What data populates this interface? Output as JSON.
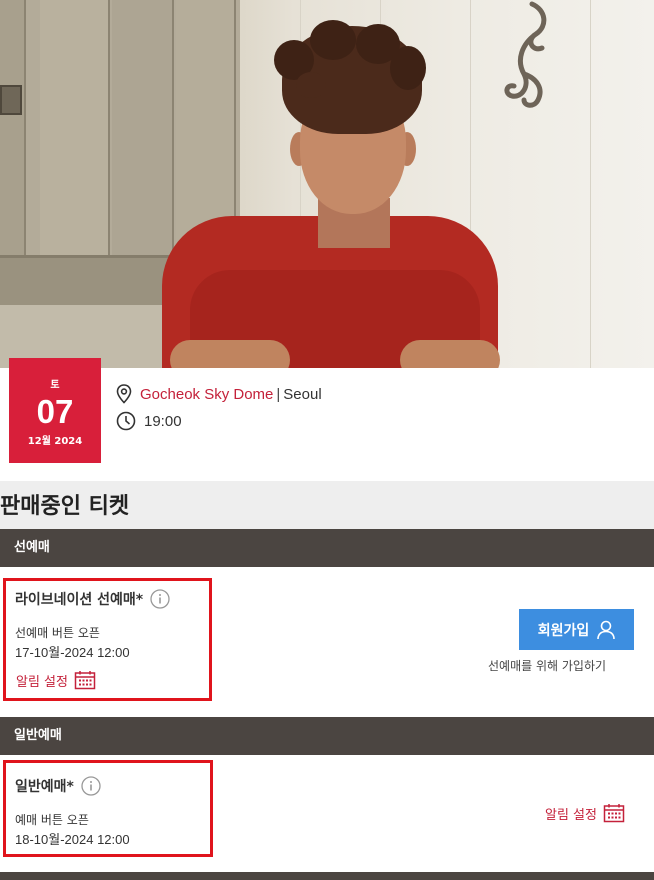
{
  "event": {
    "date_day": "토",
    "date_num": "07",
    "date_month": "12월 2024",
    "venue": "Gocheok Sky Dome",
    "city": "Seoul",
    "time": "19:00"
  },
  "tickets": {
    "title": "판매중인 티켓",
    "presale": {
      "header": "선예매",
      "name": "라이브네이션 선예매*",
      "open_label": "선예매 버튼 오픈",
      "open_date": "17-10월-2024 12:00",
      "alert_label": "알림 설정",
      "signup_button": "회원가입",
      "signup_note": "선예매를 위해 가입하기"
    },
    "general": {
      "header": "일반예매",
      "name": "일반예매*",
      "open_label": "예매 버튼 오픈",
      "open_date": "18-10월-2024 12:00",
      "alert_label": "알림 설정"
    }
  },
  "colors": {
    "accent_red": "#d81f3a",
    "link_red": "#c4213a",
    "header_dark": "#4b4541",
    "button_blue": "#3d8ee0",
    "highlight_box": "#e0141c"
  },
  "icons": [
    "location-pin-icon",
    "clock-icon",
    "info-icon",
    "calendar-icon",
    "user-icon"
  ]
}
